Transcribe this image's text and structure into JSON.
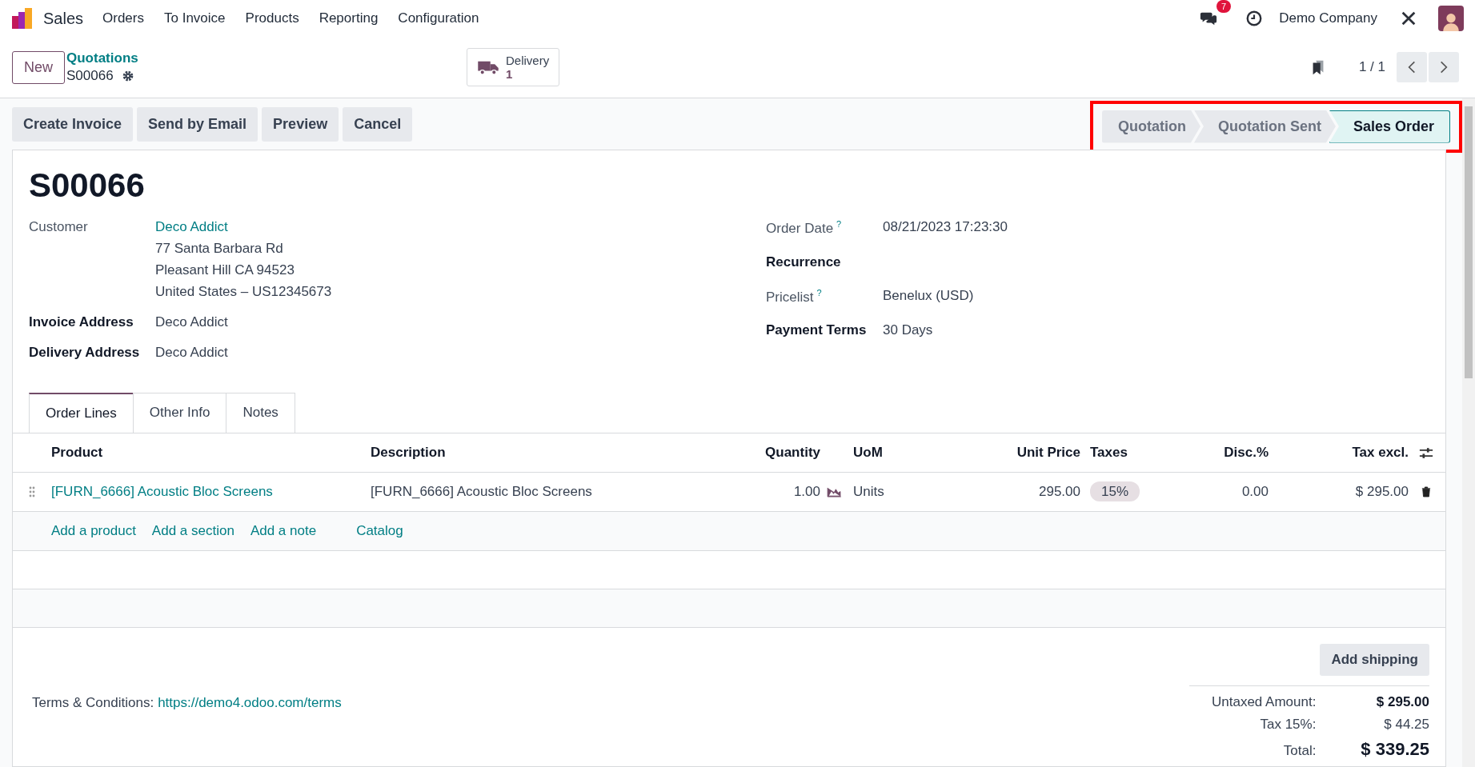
{
  "navbar": {
    "app_name": "Sales",
    "menu": [
      "Orders",
      "To Invoice",
      "Products",
      "Reporting",
      "Configuration"
    ],
    "messages_badge": "7",
    "company": "Demo Company"
  },
  "control_panel": {
    "new_button": "New",
    "breadcrumb": "Quotations",
    "record_name": "S00066",
    "smart_button": {
      "label": "Delivery",
      "count": "1"
    },
    "pager": "1 / 1"
  },
  "actions": [
    "Create Invoice",
    "Send by Email",
    "Preview",
    "Cancel"
  ],
  "status_bar": [
    {
      "label": "Quotation",
      "selected": false
    },
    {
      "label": "Quotation Sent",
      "selected": false
    },
    {
      "label": "Sales Order",
      "selected": true
    }
  ],
  "form": {
    "title": "S00066",
    "left_fields": [
      {
        "label": "Customer",
        "kind": "customer",
        "value": "Deco Addict",
        "lines": [
          "77 Santa Barbara Rd",
          "Pleasant Hill CA 94523",
          "United States – US12345673"
        ]
      },
      {
        "label": "Invoice Address",
        "kind": "plain",
        "value": "Deco Addict"
      },
      {
        "label": "Delivery Address",
        "kind": "plain",
        "value": "Deco Addict"
      }
    ],
    "right_fields": [
      {
        "label": "Order Date",
        "kind": "help",
        "help": "?",
        "value": "08/21/2023 17:23:30"
      },
      {
        "label": "Recurrence",
        "kind": "bold"
      },
      {
        "label": "Pricelist",
        "kind": "help",
        "help": "?",
        "value": "Benelux (USD)"
      },
      {
        "label": "Payment Terms",
        "kind": "bold",
        "value": "30 Days"
      }
    ]
  },
  "tabs": [
    {
      "label": "Order Lines",
      "selected": true
    },
    {
      "label": "Other Info",
      "selected": false
    },
    {
      "label": "Notes",
      "selected": false
    }
  ],
  "table": {
    "columns": [
      "Product",
      "Description",
      "Quantity",
      "UoM",
      "Unit Price",
      "Taxes",
      "Disc.%",
      "Tax excl."
    ],
    "rows": [
      {
        "product": "[FURN_6666] Acoustic Bloc Screens",
        "description": "[FURN_6666] Acoustic Bloc Screens",
        "quantity": "1.00",
        "uom": "Units",
        "unit_price": "295.00",
        "taxes": "15%",
        "discount": "0.00",
        "subtotal": "$ 295.00"
      }
    ],
    "add_links": [
      "Add a product",
      "Add a section",
      "Add a note",
      "Catalog"
    ]
  },
  "footer": {
    "add_shipping": "Add shipping",
    "terms_label": "Terms & Conditions:",
    "terms_link": "https://demo4.odoo.com/terms",
    "totals": [
      {
        "label": "Untaxed Amount:",
        "value": "$ 295.00",
        "kind": "bold"
      },
      {
        "label": "Tax 15%:",
        "value": "$ 44.25",
        "kind": "plain"
      },
      {
        "label": "Total:",
        "value": "$ 339.25",
        "kind": "total"
      }
    ]
  }
}
